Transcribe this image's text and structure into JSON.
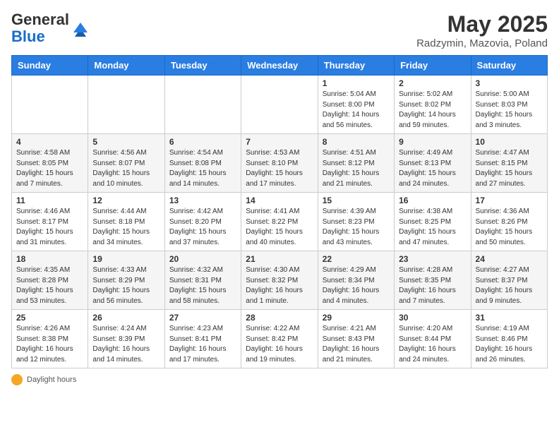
{
  "header": {
    "logo_general": "General",
    "logo_blue": "Blue",
    "month_year": "May 2025",
    "location": "Radzymin, Mazovia, Poland"
  },
  "days_of_week": [
    "Sunday",
    "Monday",
    "Tuesday",
    "Wednesday",
    "Thursday",
    "Friday",
    "Saturday"
  ],
  "weeks": [
    [
      {
        "day": "",
        "detail": ""
      },
      {
        "day": "",
        "detail": ""
      },
      {
        "day": "",
        "detail": ""
      },
      {
        "day": "",
        "detail": ""
      },
      {
        "day": "1",
        "detail": "Sunrise: 5:04 AM\nSunset: 8:00 PM\nDaylight: 14 hours\nand 56 minutes."
      },
      {
        "day": "2",
        "detail": "Sunrise: 5:02 AM\nSunset: 8:02 PM\nDaylight: 14 hours\nand 59 minutes."
      },
      {
        "day": "3",
        "detail": "Sunrise: 5:00 AM\nSunset: 8:03 PM\nDaylight: 15 hours\nand 3 minutes."
      }
    ],
    [
      {
        "day": "4",
        "detail": "Sunrise: 4:58 AM\nSunset: 8:05 PM\nDaylight: 15 hours\nand 7 minutes."
      },
      {
        "day": "5",
        "detail": "Sunrise: 4:56 AM\nSunset: 8:07 PM\nDaylight: 15 hours\nand 10 minutes."
      },
      {
        "day": "6",
        "detail": "Sunrise: 4:54 AM\nSunset: 8:08 PM\nDaylight: 15 hours\nand 14 minutes."
      },
      {
        "day": "7",
        "detail": "Sunrise: 4:53 AM\nSunset: 8:10 PM\nDaylight: 15 hours\nand 17 minutes."
      },
      {
        "day": "8",
        "detail": "Sunrise: 4:51 AM\nSunset: 8:12 PM\nDaylight: 15 hours\nand 21 minutes."
      },
      {
        "day": "9",
        "detail": "Sunrise: 4:49 AM\nSunset: 8:13 PM\nDaylight: 15 hours\nand 24 minutes."
      },
      {
        "day": "10",
        "detail": "Sunrise: 4:47 AM\nSunset: 8:15 PM\nDaylight: 15 hours\nand 27 minutes."
      }
    ],
    [
      {
        "day": "11",
        "detail": "Sunrise: 4:46 AM\nSunset: 8:17 PM\nDaylight: 15 hours\nand 31 minutes."
      },
      {
        "day": "12",
        "detail": "Sunrise: 4:44 AM\nSunset: 8:18 PM\nDaylight: 15 hours\nand 34 minutes."
      },
      {
        "day": "13",
        "detail": "Sunrise: 4:42 AM\nSunset: 8:20 PM\nDaylight: 15 hours\nand 37 minutes."
      },
      {
        "day": "14",
        "detail": "Sunrise: 4:41 AM\nSunset: 8:22 PM\nDaylight: 15 hours\nand 40 minutes."
      },
      {
        "day": "15",
        "detail": "Sunrise: 4:39 AM\nSunset: 8:23 PM\nDaylight: 15 hours\nand 43 minutes."
      },
      {
        "day": "16",
        "detail": "Sunrise: 4:38 AM\nSunset: 8:25 PM\nDaylight: 15 hours\nand 47 minutes."
      },
      {
        "day": "17",
        "detail": "Sunrise: 4:36 AM\nSunset: 8:26 PM\nDaylight: 15 hours\nand 50 minutes."
      }
    ],
    [
      {
        "day": "18",
        "detail": "Sunrise: 4:35 AM\nSunset: 8:28 PM\nDaylight: 15 hours\nand 53 minutes."
      },
      {
        "day": "19",
        "detail": "Sunrise: 4:33 AM\nSunset: 8:29 PM\nDaylight: 15 hours\nand 56 minutes."
      },
      {
        "day": "20",
        "detail": "Sunrise: 4:32 AM\nSunset: 8:31 PM\nDaylight: 15 hours\nand 58 minutes."
      },
      {
        "day": "21",
        "detail": "Sunrise: 4:30 AM\nSunset: 8:32 PM\nDaylight: 16 hours\nand 1 minute."
      },
      {
        "day": "22",
        "detail": "Sunrise: 4:29 AM\nSunset: 8:34 PM\nDaylight: 16 hours\nand 4 minutes."
      },
      {
        "day": "23",
        "detail": "Sunrise: 4:28 AM\nSunset: 8:35 PM\nDaylight: 16 hours\nand 7 minutes."
      },
      {
        "day": "24",
        "detail": "Sunrise: 4:27 AM\nSunset: 8:37 PM\nDaylight: 16 hours\nand 9 minutes."
      }
    ],
    [
      {
        "day": "25",
        "detail": "Sunrise: 4:26 AM\nSunset: 8:38 PM\nDaylight: 16 hours\nand 12 minutes."
      },
      {
        "day": "26",
        "detail": "Sunrise: 4:24 AM\nSunset: 8:39 PM\nDaylight: 16 hours\nand 14 minutes."
      },
      {
        "day": "27",
        "detail": "Sunrise: 4:23 AM\nSunset: 8:41 PM\nDaylight: 16 hours\nand 17 minutes."
      },
      {
        "day": "28",
        "detail": "Sunrise: 4:22 AM\nSunset: 8:42 PM\nDaylight: 16 hours\nand 19 minutes."
      },
      {
        "day": "29",
        "detail": "Sunrise: 4:21 AM\nSunset: 8:43 PM\nDaylight: 16 hours\nand 21 minutes."
      },
      {
        "day": "30",
        "detail": "Sunrise: 4:20 AM\nSunset: 8:44 PM\nDaylight: 16 hours\nand 24 minutes."
      },
      {
        "day": "31",
        "detail": "Sunrise: 4:19 AM\nSunset: 8:46 PM\nDaylight: 16 hours\nand 26 minutes."
      }
    ]
  ],
  "footer": {
    "daylight_label": "Daylight hours"
  }
}
